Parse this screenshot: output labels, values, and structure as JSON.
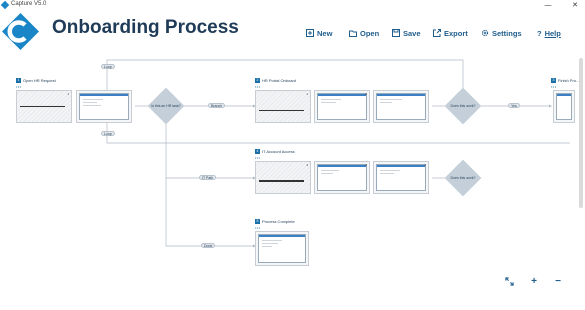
{
  "window": {
    "title": "Capture V5.0",
    "minimize": "—",
    "close": "✕"
  },
  "header": {
    "app_title": "Onboarding Process"
  },
  "toolbar": {
    "new_label": "New",
    "open_label": "Open",
    "save_label": "Save",
    "export_label": "Export",
    "settings_label": "Settings",
    "help_label": "Help"
  },
  "flow": {
    "steps": [
      {
        "num": "1",
        "label": "Open HR Request"
      },
      {
        "num": "2",
        "label": "HR Portal Onboard"
      },
      {
        "num": "3",
        "label": "Finish Pro..."
      },
      {
        "num": "4",
        "label": "IT Account Access"
      },
      {
        "num": "5",
        "label": "Process Complete"
      }
    ],
    "decisions": [
      {
        "label": "Is this an HR task?"
      },
      {
        "label": "Does this work?"
      },
      {
        "label": "Does this work?"
      }
    ],
    "connectors": [
      {
        "label": "Loop"
      },
      {
        "label": "Branch"
      },
      {
        "label": "Yes"
      },
      {
        "label": "Loop"
      },
      {
        "label": "IT Path"
      },
      {
        "label": "Done"
      }
    ],
    "thumb_counts": [
      "1",
      "1",
      "2",
      "4",
      "2",
      "1"
    ]
  },
  "controls": {
    "fit_icon": "expand-icon",
    "zoom_in": "+",
    "zoom_out": "−"
  },
  "colors": {
    "brand": "#1b86c7",
    "title": "#1f3b57",
    "toolbar": "#1f5d8c",
    "diamond": "#c4cfd9"
  }
}
